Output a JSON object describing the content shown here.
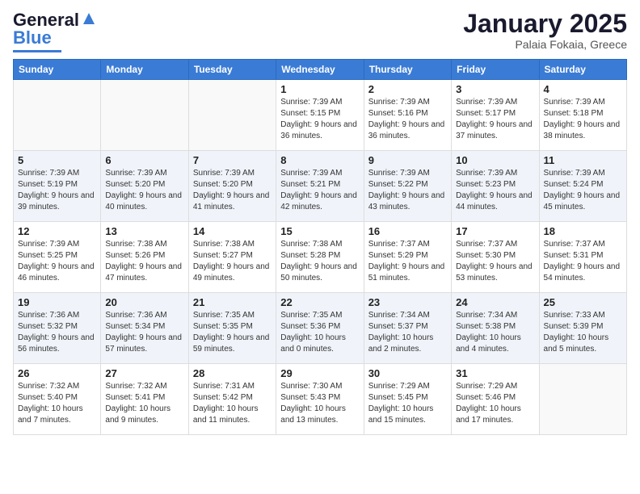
{
  "logo": {
    "line1": "General",
    "line2": "Blue"
  },
  "title": "January 2025",
  "location": "Palaia Fokaia, Greece",
  "days_of_week": [
    "Sunday",
    "Monday",
    "Tuesday",
    "Wednesday",
    "Thursday",
    "Friday",
    "Saturday"
  ],
  "weeks": [
    [
      {
        "day": "",
        "info": ""
      },
      {
        "day": "",
        "info": ""
      },
      {
        "day": "",
        "info": ""
      },
      {
        "day": "1",
        "info": "Sunrise: 7:39 AM\nSunset: 5:15 PM\nDaylight: 9 hours and 36 minutes."
      },
      {
        "day": "2",
        "info": "Sunrise: 7:39 AM\nSunset: 5:16 PM\nDaylight: 9 hours and 36 minutes."
      },
      {
        "day": "3",
        "info": "Sunrise: 7:39 AM\nSunset: 5:17 PM\nDaylight: 9 hours and 37 minutes."
      },
      {
        "day": "4",
        "info": "Sunrise: 7:39 AM\nSunset: 5:18 PM\nDaylight: 9 hours and 38 minutes."
      }
    ],
    [
      {
        "day": "5",
        "info": "Sunrise: 7:39 AM\nSunset: 5:19 PM\nDaylight: 9 hours and 39 minutes."
      },
      {
        "day": "6",
        "info": "Sunrise: 7:39 AM\nSunset: 5:20 PM\nDaylight: 9 hours and 40 minutes."
      },
      {
        "day": "7",
        "info": "Sunrise: 7:39 AM\nSunset: 5:20 PM\nDaylight: 9 hours and 41 minutes."
      },
      {
        "day": "8",
        "info": "Sunrise: 7:39 AM\nSunset: 5:21 PM\nDaylight: 9 hours and 42 minutes."
      },
      {
        "day": "9",
        "info": "Sunrise: 7:39 AM\nSunset: 5:22 PM\nDaylight: 9 hours and 43 minutes."
      },
      {
        "day": "10",
        "info": "Sunrise: 7:39 AM\nSunset: 5:23 PM\nDaylight: 9 hours and 44 minutes."
      },
      {
        "day": "11",
        "info": "Sunrise: 7:39 AM\nSunset: 5:24 PM\nDaylight: 9 hours and 45 minutes."
      }
    ],
    [
      {
        "day": "12",
        "info": "Sunrise: 7:39 AM\nSunset: 5:25 PM\nDaylight: 9 hours and 46 minutes."
      },
      {
        "day": "13",
        "info": "Sunrise: 7:38 AM\nSunset: 5:26 PM\nDaylight: 9 hours and 47 minutes."
      },
      {
        "day": "14",
        "info": "Sunrise: 7:38 AM\nSunset: 5:27 PM\nDaylight: 9 hours and 49 minutes."
      },
      {
        "day": "15",
        "info": "Sunrise: 7:38 AM\nSunset: 5:28 PM\nDaylight: 9 hours and 50 minutes."
      },
      {
        "day": "16",
        "info": "Sunrise: 7:37 AM\nSunset: 5:29 PM\nDaylight: 9 hours and 51 minutes."
      },
      {
        "day": "17",
        "info": "Sunrise: 7:37 AM\nSunset: 5:30 PM\nDaylight: 9 hours and 53 minutes."
      },
      {
        "day": "18",
        "info": "Sunrise: 7:37 AM\nSunset: 5:31 PM\nDaylight: 9 hours and 54 minutes."
      }
    ],
    [
      {
        "day": "19",
        "info": "Sunrise: 7:36 AM\nSunset: 5:32 PM\nDaylight: 9 hours and 56 minutes."
      },
      {
        "day": "20",
        "info": "Sunrise: 7:36 AM\nSunset: 5:34 PM\nDaylight: 9 hours and 57 minutes."
      },
      {
        "day": "21",
        "info": "Sunrise: 7:35 AM\nSunset: 5:35 PM\nDaylight: 9 hours and 59 minutes."
      },
      {
        "day": "22",
        "info": "Sunrise: 7:35 AM\nSunset: 5:36 PM\nDaylight: 10 hours and 0 minutes."
      },
      {
        "day": "23",
        "info": "Sunrise: 7:34 AM\nSunset: 5:37 PM\nDaylight: 10 hours and 2 minutes."
      },
      {
        "day": "24",
        "info": "Sunrise: 7:34 AM\nSunset: 5:38 PM\nDaylight: 10 hours and 4 minutes."
      },
      {
        "day": "25",
        "info": "Sunrise: 7:33 AM\nSunset: 5:39 PM\nDaylight: 10 hours and 5 minutes."
      }
    ],
    [
      {
        "day": "26",
        "info": "Sunrise: 7:32 AM\nSunset: 5:40 PM\nDaylight: 10 hours and 7 minutes."
      },
      {
        "day": "27",
        "info": "Sunrise: 7:32 AM\nSunset: 5:41 PM\nDaylight: 10 hours and 9 minutes."
      },
      {
        "day": "28",
        "info": "Sunrise: 7:31 AM\nSunset: 5:42 PM\nDaylight: 10 hours and 11 minutes."
      },
      {
        "day": "29",
        "info": "Sunrise: 7:30 AM\nSunset: 5:43 PM\nDaylight: 10 hours and 13 minutes."
      },
      {
        "day": "30",
        "info": "Sunrise: 7:29 AM\nSunset: 5:45 PM\nDaylight: 10 hours and 15 minutes."
      },
      {
        "day": "31",
        "info": "Sunrise: 7:29 AM\nSunset: 5:46 PM\nDaylight: 10 hours and 17 minutes."
      },
      {
        "day": "",
        "info": ""
      }
    ]
  ]
}
